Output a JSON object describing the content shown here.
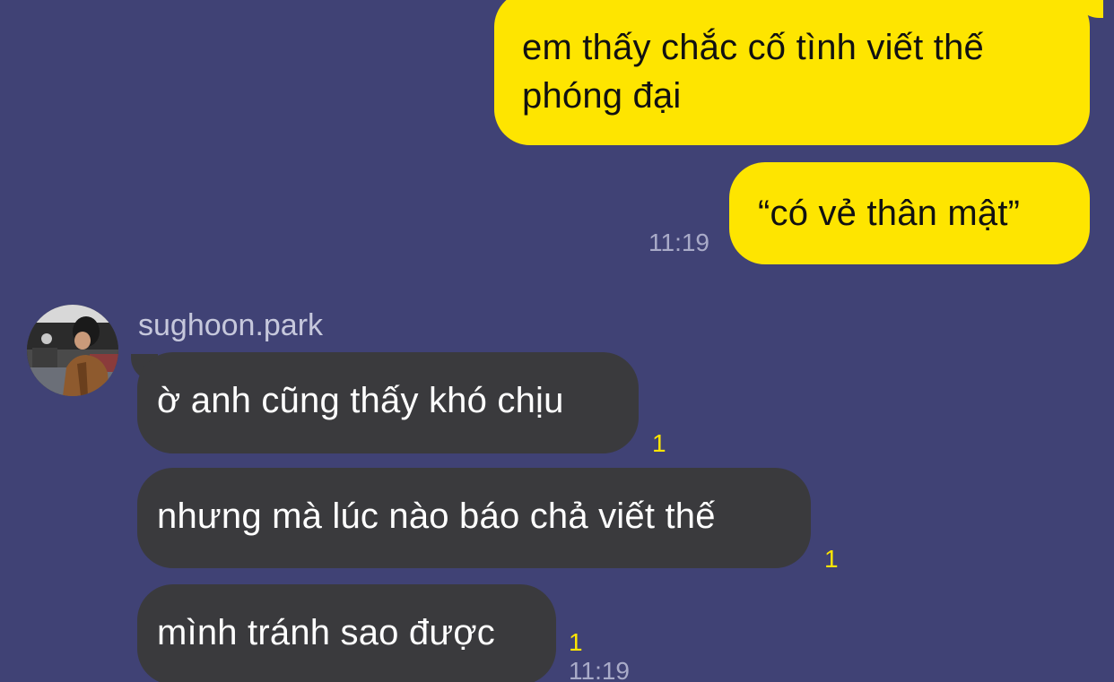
{
  "colors": {
    "background": "#404275",
    "outgoing_bubble": "#FEE500",
    "incoming_bubble": "#3a3a3d",
    "unread_count": "#FEE500",
    "timestamp": "#a9abc8"
  },
  "outgoing": [
    {
      "text": "em thấy chắc cố tình viết thế\nphóng đại"
    },
    {
      "text": "“có vẻ thân mật”",
      "time": "11:19"
    }
  ],
  "incoming": {
    "sender": "sughoon.park",
    "avatar_icon": "avatar-photo",
    "messages": [
      {
        "text": "ờ anh cũng thấy khó chịu",
        "unread": "1"
      },
      {
        "text": "nhưng mà lúc nào báo chả viết thế",
        "unread": "1"
      },
      {
        "text": "mình tránh sao được",
        "unread": "1",
        "time": "11:19"
      }
    ]
  }
}
